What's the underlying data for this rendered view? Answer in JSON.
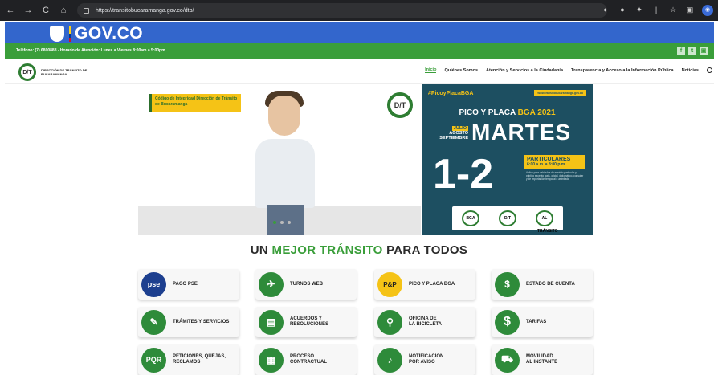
{
  "browser": {
    "url": "https://transitobucaramanga.gov.co/dtb/",
    "back": "←",
    "forward": "→",
    "reload": "C",
    "home": "⌂",
    "toolbar_icons": [
      "◐",
      "●",
      "✦",
      "|",
      "☆",
      "▣"
    ],
    "profile": "◉"
  },
  "gov_bar": {
    "logo_text": "GOV.CO"
  },
  "info_bar": {
    "text": "Teléfono: (7) 6800888 - Horario de Atención: Lunes a Viernes 8:00am a 5:00pm",
    "social": [
      "f",
      "t",
      "▣"
    ]
  },
  "site_header": {
    "logo_mark": "D/T",
    "logo_text": "DIRECCIÓN DE TRÁNSITO DE BUCARAMANGA",
    "menu": [
      "Inicio",
      "Quiénes Somos",
      "Atención y Servicios a la Ciudadanía",
      "Transparencia y Acceso a la Información Pública",
      "Noticias"
    ]
  },
  "hero_left": {
    "label": "Código de Integridad Dirección de Tránsito de Bucaramanga",
    "logo_mark": "D/T"
  },
  "hero_right": {
    "tag": "#PicoyPlacaBGA",
    "url": "www.transitobucaramanga.gov.co",
    "title_main": "PICO Y PLACA ",
    "title_hl": "BGA 2021",
    "month1": "JULIO",
    "month2": "AGOSTO",
    "month3": "SEPTIEMBRE",
    "day": "MARTES",
    "digits": "1-2",
    "category": "PARTICULARES",
    "hours": "6:00 a.m. a 8:00 p.m.",
    "note": "Aplica para vehículos de servicio particular y público excepto taxis, oficial, diplomático, consular y de importación temporal o asimilada",
    "foot_marks": [
      "BGA",
      "D/T",
      "AL TRÁNSITO"
    ]
  },
  "main": {
    "title_a": "UN ",
    "title_hl": "MEJOR TRÁNSITO",
    "title_b": " PARA TODOS"
  },
  "services": [
    {
      "icon": "pse",
      "label": "PAGO PSE"
    },
    {
      "icon": "✈",
      "label": "TURNOS WEB"
    },
    {
      "icon": "P&P",
      "label": "PICO Y PLACA BGA"
    },
    {
      "icon": "$",
      "label": "ESTADO DE CUENTA"
    },
    {
      "icon": "✎",
      "label": "TRÁMITES Y SERVICIOS"
    },
    {
      "icon": "▤",
      "label": "ACUERDOS Y\nRESOLUCIONES"
    },
    {
      "icon": "⚲",
      "label": "OFICINA DE\nLA BICICLETA"
    },
    {
      "icon": "$",
      "label": "TARIFAS"
    },
    {
      "icon": "PQR",
      "label": "PETICIONES, QUEJAS,\nRECLAMOS"
    },
    {
      "icon": "▦",
      "label": "PROCESO\nCONTRACTUAL"
    },
    {
      "icon": "♪",
      "label": "NOTIFICACIÓN\nPOR AVISO"
    },
    {
      "icon": "⛟",
      "label": "MOVILIDAD\nAL INSTANTE"
    }
  ]
}
